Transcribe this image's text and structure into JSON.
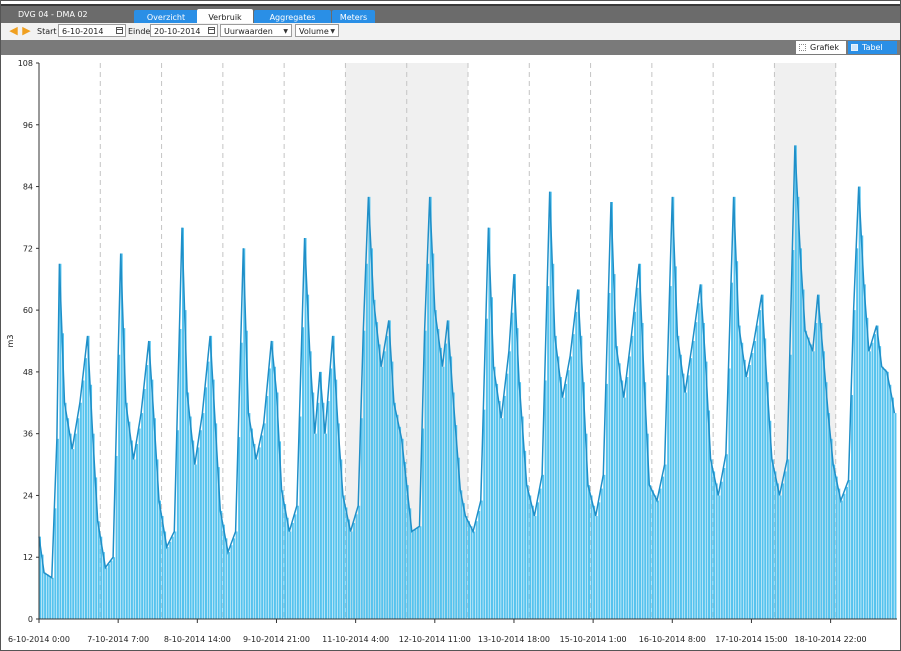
{
  "app": {
    "title": "DVG 04 - DMA 02"
  },
  "tabs": [
    {
      "label": "Overzicht",
      "active": false
    },
    {
      "label": "Verbruik",
      "active": true
    },
    {
      "label": "Aggregates",
      "active": false
    },
    {
      "label": "Meters",
      "active": false
    }
  ],
  "toolbar": {
    "start_label": "Start",
    "start_value": "6-10-2014",
    "end_label": "Einde",
    "end_value": "20-10-2014",
    "resolution_value": "Uurwaarden",
    "measure_value": "Volume"
  },
  "view_tabs": [
    {
      "label": "Grafiek",
      "active": true
    },
    {
      "label": "Tabel",
      "active": false
    }
  ],
  "colors": {
    "accent": "#2a8fe6",
    "series_fill": "#56c3ee",
    "series_line": "#1f8fc8",
    "shade": "#f0f0f0"
  },
  "chart_data": {
    "type": "area",
    "ylabel": "m3",
    "ylim": [
      0,
      108
    ],
    "yticks": [
      0,
      12,
      24,
      36,
      48,
      60,
      72,
      84,
      96,
      108
    ],
    "xlim": [
      "6-10-2014 0:00",
      "20-10-2014 0:00"
    ],
    "xtick_labels": [
      "6-10-2014 0:00",
      "7-10-2014 7:00",
      "8-10-2014 14:00",
      "9-10-2014 21:00",
      "11-10-2014 4:00",
      "12-10-2014 11:00",
      "13-10-2014 18:00",
      "15-10-2014 1:00",
      "16-10-2014 8:00",
      "17-10-2014 15:00",
      "18-10-2014 22:00"
    ],
    "shaded_periods": [
      [
        "11-10-2014 0:00",
        "13-10-2014 0:00"
      ],
      [
        "18-10-2014 0:00",
        "19-10-2014 0:00"
      ]
    ],
    "gridlines": "vertical dashed at day boundaries",
    "series": [
      {
        "points": [
          [
            "6-10-2014 0:00",
            16
          ],
          [
            "6-10-2014 2:00",
            9
          ],
          [
            "6-10-2014 5:00",
            8
          ],
          [
            "6-10-2014 7:00",
            35
          ],
          [
            "6-10-2014 8:00",
            69
          ],
          [
            "6-10-2014 10:00",
            42
          ],
          [
            "6-10-2014 13:00",
            33
          ],
          [
            "6-10-2014 16:00",
            42
          ],
          [
            "6-10-2014 19:00",
            55
          ],
          [
            "6-10-2014 21:00",
            36
          ],
          [
            "6-10-2014 23:00",
            19
          ],
          [
            "7-10-2014 2:00",
            10
          ],
          [
            "7-10-2014 5:00",
            12
          ],
          [
            "7-10-2014 8:00",
            71
          ],
          [
            "7-10-2014 10:00",
            42
          ],
          [
            "7-10-2014 13:00",
            31
          ],
          [
            "7-10-2014 16:00",
            40
          ],
          [
            "7-10-2014 19:00",
            54
          ],
          [
            "7-10-2014 21:00",
            39
          ],
          [
            "7-10-2014 23:00",
            23
          ],
          [
            "8-10-2014 2:00",
            14
          ],
          [
            "8-10-2014 5:00",
            17
          ],
          [
            "8-10-2014 8:00",
            76
          ],
          [
            "8-10-2014 10:00",
            44
          ],
          [
            "8-10-2014 13:00",
            30
          ],
          [
            "8-10-2014 16:00",
            40
          ],
          [
            "8-10-2014 19:00",
            55
          ],
          [
            "8-10-2014 21:00",
            38
          ],
          [
            "8-10-2014 23:00",
            21
          ],
          [
            "9-10-2014 2:00",
            13
          ],
          [
            "9-10-2014 5:00",
            17
          ],
          [
            "9-10-2014 8:00",
            72
          ],
          [
            "9-10-2014 10:00",
            40
          ],
          [
            "9-10-2014 13:00",
            31
          ],
          [
            "9-10-2014 16:00",
            38
          ],
          [
            "9-10-2014 19:00",
            54
          ],
          [
            "9-10-2014 21:00",
            44
          ],
          [
            "9-10-2014 23:00",
            25
          ],
          [
            "10-10-2014 2:00",
            17
          ],
          [
            "10-10-2014 5:00",
            22
          ],
          [
            "10-10-2014 8:00",
            74
          ],
          [
            "10-10-2014 10:00",
            52
          ],
          [
            "10-10-2014 12:00",
            36
          ],
          [
            "10-10-2014 14:00",
            48
          ],
          [
            "10-10-2014 16:00",
            36
          ],
          [
            "10-10-2014 19:00",
            55
          ],
          [
            "10-10-2014 21:00",
            38
          ],
          [
            "10-10-2014 23:00",
            24
          ],
          [
            "11-10-2014 2:00",
            17
          ],
          [
            "11-10-2014 5:00",
            22
          ],
          [
            "11-10-2014 7:00",
            56
          ],
          [
            "11-10-2014 9:00",
            82
          ],
          [
            "11-10-2014 11:00",
            62
          ],
          [
            "11-10-2014 14:00",
            49
          ],
          [
            "11-10-2014 17:00",
            58
          ],
          [
            "11-10-2014 19:00",
            42
          ],
          [
            "11-10-2014 22:00",
            35
          ],
          [
            "12-10-2014 2:00",
            17
          ],
          [
            "12-10-2014 5:00",
            18
          ],
          [
            "12-10-2014 7:00",
            56
          ],
          [
            "12-10-2014 9:00",
            82
          ],
          [
            "12-10-2014 11:00",
            60
          ],
          [
            "12-10-2014 14:00",
            49
          ],
          [
            "12-10-2014 16:00",
            58
          ],
          [
            "12-10-2014 18:00",
            44
          ],
          [
            "12-10-2014 21:00",
            25
          ],
          [
            "12-10-2014 23:00",
            20
          ],
          [
            "13-10-2014 2:00",
            17
          ],
          [
            "13-10-2014 5:00",
            23
          ],
          [
            "13-10-2014 8:00",
            76
          ],
          [
            "13-10-2014 10:00",
            49
          ],
          [
            "13-10-2014 13:00",
            39
          ],
          [
            "13-10-2014 16:00",
            52
          ],
          [
            "13-10-2014 18:00",
            67
          ],
          [
            "13-10-2014 20:00",
            46
          ],
          [
            "13-10-2014 23:00",
            26
          ],
          [
            "14-10-2014 2:00",
            20
          ],
          [
            "14-10-2014 5:00",
            28
          ],
          [
            "14-10-2014 8:00",
            83
          ],
          [
            "14-10-2014 10:00",
            55
          ],
          [
            "14-10-2014 13:00",
            43
          ],
          [
            "14-10-2014 16:00",
            51
          ],
          [
            "14-10-2014 19:00",
            64
          ],
          [
            "14-10-2014 21:00",
            46
          ],
          [
            "14-10-2014 23:00",
            26
          ],
          [
            "15-10-2014 2:00",
            20
          ],
          [
            "15-10-2014 5:00",
            28
          ],
          [
            "15-10-2014 8:00",
            81
          ],
          [
            "15-10-2014 10:00",
            53
          ],
          [
            "15-10-2014 13:00",
            43
          ],
          [
            "15-10-2014 16:00",
            55
          ],
          [
            "15-10-2014 19:00",
            69
          ],
          [
            "15-10-2014 21:00",
            46
          ],
          [
            "15-10-2014 23:00",
            26
          ],
          [
            "16-10-2014 2:00",
            23
          ],
          [
            "16-10-2014 5:00",
            30
          ],
          [
            "16-10-2014 8:00",
            82
          ],
          [
            "16-10-2014 10:00",
            55
          ],
          [
            "16-10-2014 13:00",
            44
          ],
          [
            "16-10-2014 16:00",
            54
          ],
          [
            "16-10-2014 19:00",
            65
          ],
          [
            "16-10-2014 21:00",
            50
          ],
          [
            "16-10-2014 23:00",
            31
          ],
          [
            "17-10-2014 2:00",
            24
          ],
          [
            "17-10-2014 5:00",
            32
          ],
          [
            "17-10-2014 8:00",
            82
          ],
          [
            "17-10-2014 10:00",
            57
          ],
          [
            "17-10-2014 13:00",
            47
          ],
          [
            "17-10-2014 16:00",
            54
          ],
          [
            "17-10-2014 19:00",
            63
          ],
          [
            "17-10-2014 21:00",
            46
          ],
          [
            "17-10-2014 23:00",
            31
          ],
          [
            "18-10-2014 2:00",
            24
          ],
          [
            "18-10-2014 5:00",
            31
          ],
          [
            "18-10-2014 8:00",
            92
          ],
          [
            "18-10-2014 10:00",
            72
          ],
          [
            "18-10-2014 12:00",
            56
          ],
          [
            "18-10-2014 15:00",
            52
          ],
          [
            "18-10-2014 17:00",
            63
          ],
          [
            "18-10-2014 19:00",
            52
          ],
          [
            "18-10-2014 21:00",
            40
          ],
          [
            "18-10-2014 23:00",
            30
          ],
          [
            "19-10-2014 2:00",
            23
          ],
          [
            "19-10-2014 5:00",
            27
          ],
          [
            "19-10-2014 7:00",
            60
          ],
          [
            "19-10-2014 9:00",
            84
          ],
          [
            "19-10-2014 11:00",
            65
          ],
          [
            "19-10-2014 13:00",
            52
          ],
          [
            "19-10-2014 16:00",
            57
          ],
          [
            "19-10-2014 18:00",
            49
          ],
          [
            "19-10-2014 20:00",
            48
          ],
          [
            "19-10-2014 22:00",
            43
          ],
          [
            "19-10-2014 23:00",
            40
          ]
        ]
      }
    ]
  }
}
